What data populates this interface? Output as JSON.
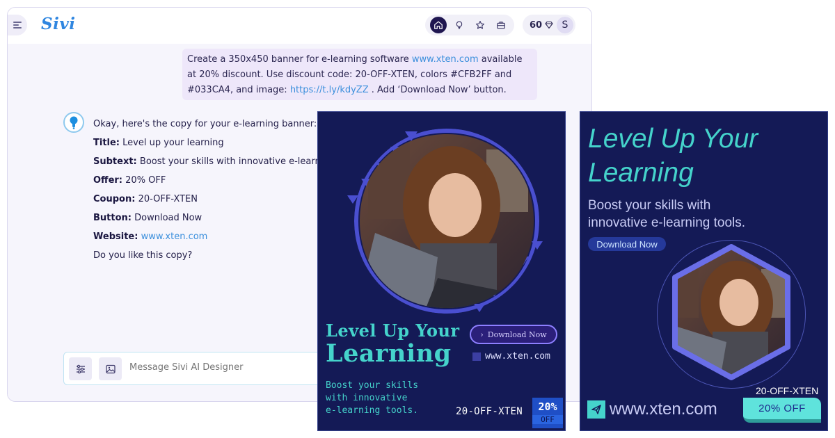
{
  "app": {
    "logo": "Sivi",
    "nav_icons": [
      "home-icon",
      "bulb-icon",
      "star-icon",
      "briefcase-icon"
    ],
    "credits": "60",
    "avatar_initial": "S"
  },
  "user_message": {
    "text_1": "Create a 350x450 banner for e-learning software ",
    "link_1": "www.xten.com",
    "text_2": " available at 20% discount. Use discount code: 20-OFF-XTEN, colors #CFB2FF and #033CA4, and image: ",
    "link_2": "https://t.ly/kdyZZ",
    "text_3": " . Add ‘Download Now’ button."
  },
  "bot_message": {
    "intro": "Okay, here's the copy for your e-learning banner:",
    "fields": [
      {
        "label": "Title:",
        "value": "Level up your learning"
      },
      {
        "label": "Subtext:",
        "value": "Boost your skills with innovative e-learning"
      },
      {
        "label": "Offer:",
        "value": "20% OFF"
      },
      {
        "label": "Coupon:",
        "value": "20-OFF-XTEN"
      },
      {
        "label": "Button:",
        "value": "Download Now"
      }
    ],
    "website_label": "Website:",
    "website_value": "www.xten.com",
    "question": "Do you like this copy?"
  },
  "composer": {
    "placeholder": "Message Sivi AI Designer"
  },
  "banner_1": {
    "title_line1": "Level Up Your",
    "title_line2": "Learning",
    "subtext_line1": "Boost your skills",
    "subtext_line2": "with innovative",
    "subtext_line3": "e-learning tools.",
    "button": "Download Now",
    "website": "www.xten.com",
    "coupon": "20-OFF-XTEN",
    "offer_pct": "20%",
    "offer_word": "OFF"
  },
  "banner_2": {
    "title_line1": "Level Up Your",
    "title_line2": "Learning",
    "subtext_line1": "Boost your skills with",
    "subtext_line2": "innovative e-learning tools.",
    "button": "Download Now",
    "website": "www.xten.com",
    "coupon": "20-OFF-XTEN",
    "offer": "20% OFF"
  },
  "colors": {
    "brand_blue": "#2f86e0",
    "banner_bg": "#141a56",
    "teal": "#45d3cb",
    "accent_purple": "#8d7fff"
  }
}
